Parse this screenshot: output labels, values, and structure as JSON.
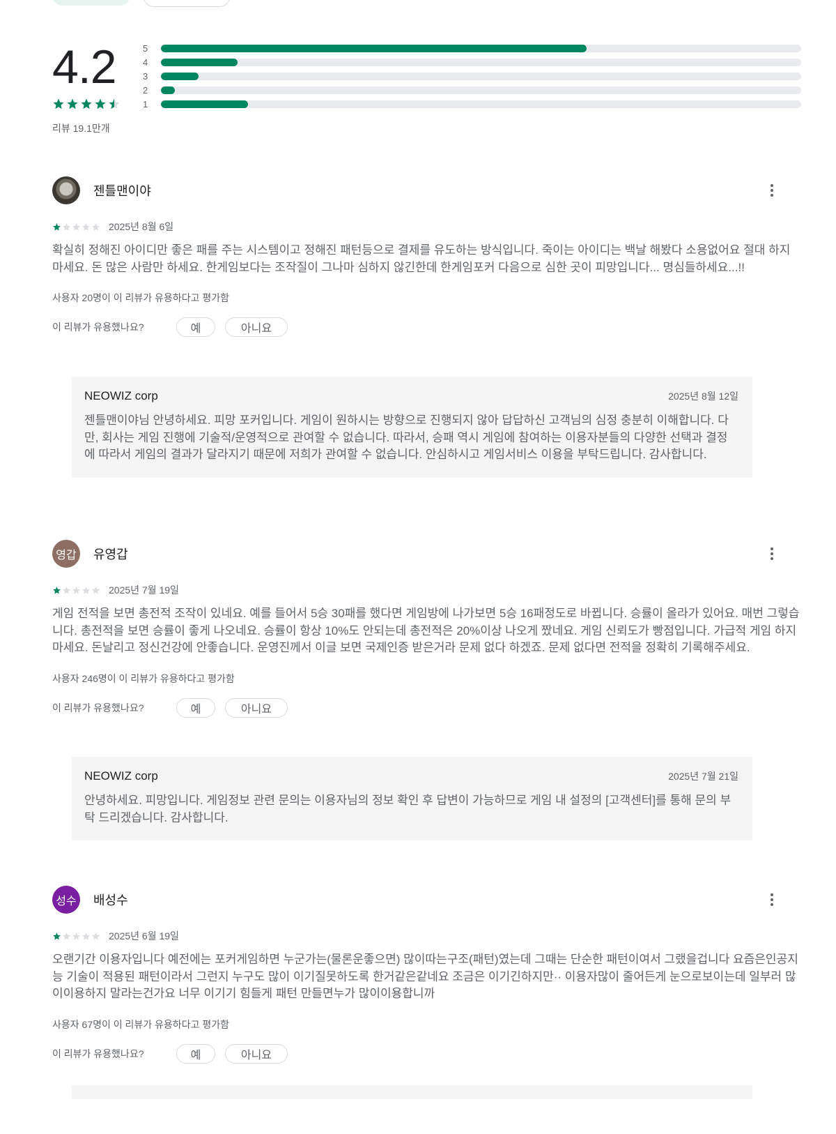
{
  "summary": {
    "score": "4.2",
    "star_rating": 4.5,
    "review_count_label": "리뷰 19.1만개",
    "distribution": [
      {
        "label": "5",
        "fraction": 0.665
      },
      {
        "label": "4",
        "fraction": 0.12
      },
      {
        "label": "3",
        "fraction": 0.059
      },
      {
        "label": "2",
        "fraction": 0.022
      },
      {
        "label": "1",
        "fraction": 0.136
      }
    ]
  },
  "colors": {
    "accent": "#01875f",
    "track": "#e8eaed",
    "text_secondary": "#5f6368"
  },
  "reviews": [
    {
      "author": "젠틀맨이야",
      "avatar_initials": "",
      "avatar_color": "",
      "rating": 1,
      "date": "2025년 8월 6일",
      "body": "확실히 정해진 아이디만 좋은 패를 주는 시스템이고 정해진 패턴등으로 결제를 유도하는 방식입니다. 죽이는 아이디는 백날 해봤다 소용없어요 절대 하지마세요. 돈 많은 사람만 하세요. 한게임보다는 조작질이 그나마 심하지 않긴한데 한게임포커 다음으로 심한 곳이 피망입니다... 명심들하세요...!!",
      "helpful_count": "사용자 20명이 이 리뷰가 유용하다고 평가함",
      "helpful_question": "이 리뷰가 유용했나요?",
      "yes_label": "예",
      "no_label": "아니요",
      "reply": {
        "developer": "NEOWIZ corp",
        "date": "2025년 8월 12일",
        "body": "젠틀맨이야님 안녕하세요. 피망 포커입니다. 게임이 원하시는 방향으로 진행되지 않아 답답하신 고객님의 심정 충분히 이해합니다. 다만, 회사는 게임 진행에 기술적/운영적으로 관여할 수 없습니다. 따라서, 승패 역시 게임에 참여하는 이용자분들의 다양한 선택과 결정에 따라서 게임의 결과가 달라지기 때문에 저희가 관여할 수 없습니다. 안심하시고 게임서비스 이용을 부탁드립니다. 감사합니다."
      }
    },
    {
      "author": "유영갑",
      "avatar_initials": "영갑",
      "avatar_color": "#8d6e63",
      "rating": 1,
      "date": "2025년 7월 19일",
      "body": "게임 전적을 보면 총전적 조작이 있네요. 예를 들어서 5승 30패를 했다면 게임방에 나가보면 5승 16패정도로 바뀝니다. 승률이 올라가 있어요. 매번 그렇습니다. 총전적을 보면 승률이 좋게 나오네요. 승률이 항상 10%도 안되는데 총전적은 20%이상 나오게 짰네요. 게임 신뢰도가 빵점입니다. 가급적 게임 하지 마세요. 돈날리고 정신건강에 안좋습니다. 운영진께서 이글 보면 국제인증 받은거라 문제 없다 하겠죠. 문제 없다면 전적을 정확히 기록해주세요.",
      "helpful_count": "사용자 246명이 이 리뷰가 유용하다고 평가함",
      "helpful_question": "이 리뷰가 유용했나요?",
      "yes_label": "예",
      "no_label": "아니요",
      "reply": {
        "developer": "NEOWIZ corp",
        "date": "2025년 7월 21일",
        "body": "안녕하세요. 피망입니다. 게임정보 관련 문의는 이용자님의 정보 확인 후 답변이 가능하므로 게임 내 설정의 [고객센터]를 통해 문의 부탁 드리겠습니다. 감사합니다."
      }
    },
    {
      "author": "배성수",
      "avatar_initials": "성수",
      "avatar_color": "#7b1fa2",
      "rating": 1,
      "date": "2025년 6월 19일",
      "body": "오랜기간 이용자입니다 예전에는 포커게임하면 누군가는(물론운좋으면) 많이따는구조(패턴)였는데 그때는 단순한 패턴이여서 그랬을겁니다 요즘은인공지능 기술이 적용된 패턴이라서 그런지 누구도 많이 이기질못하도록 한거같은같네요 조금은 이기긴하지만·· 이용자많이 줄어든게 눈으로보이는데 일부러 많이이용하지 말라는건가요 너무 이기기 힘들게 패턴 만들면누가 많이이용합니까",
      "helpful_count": "사용자 67명이 이 리뷰가 유용하다고 평가함",
      "helpful_question": "이 리뷰가 유용했나요?",
      "yes_label": "예",
      "no_label": "아니요"
    }
  ]
}
